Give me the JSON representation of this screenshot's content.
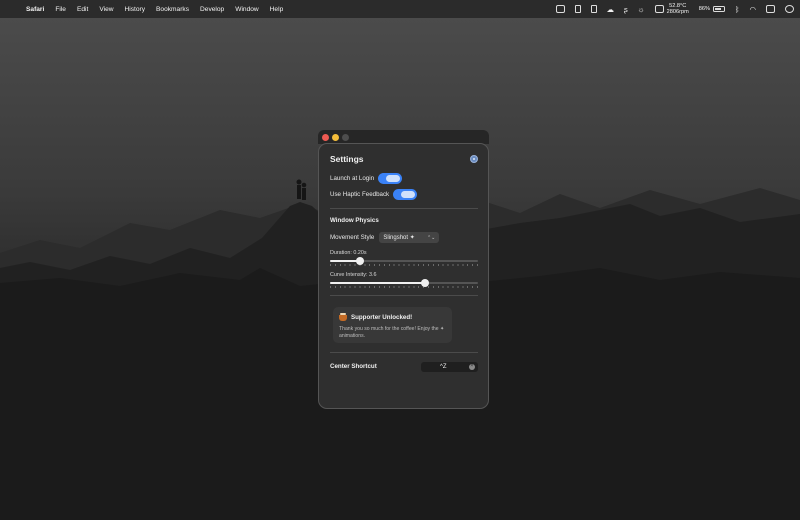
{
  "menubar": {
    "app_name": "Safari",
    "items": [
      "File",
      "Edit",
      "View",
      "History",
      "Bookmarks",
      "Develop",
      "Window",
      "Help"
    ],
    "status": {
      "temperature": "52.8°C",
      "fan_speed": "2806rpm",
      "battery_percent": "86%",
      "icons": [
        "finder-window-icon",
        "sd-card-icon",
        "phone-icon",
        "cloud-icon",
        "script-icon",
        "sun-icon",
        "stats-icon",
        "battery-icon",
        "bluetooth-icon",
        "wifi-icon",
        "control-center-icon",
        "clock-icon"
      ]
    }
  },
  "settings": {
    "title": "Settings",
    "toggles": [
      {
        "label": "Launch at Login",
        "on": true
      },
      {
        "label": "Use Haptic Feedback",
        "on": true
      }
    ],
    "physics": {
      "heading": "Window Physics",
      "movement_style_label": "Movement Style",
      "movement_style_value": "Slingshot ✦",
      "duration_label": "Duration: 0.20s",
      "duration_fraction": 0.2,
      "curve_label": "Curve Intensity: 3.6",
      "curve_fraction": 0.64
    },
    "supporter": {
      "title": "Supporter Unlocked!",
      "message": "Thank you so much for the coffee! Enjoy the ✦ animations."
    },
    "shortcut": {
      "label": "Center Shortcut",
      "value": "^Z"
    }
  },
  "colors": {
    "accent": "#3a82f7",
    "panel_bg": "#2f2f2f",
    "menubar_bg": "#2b2b2b"
  }
}
